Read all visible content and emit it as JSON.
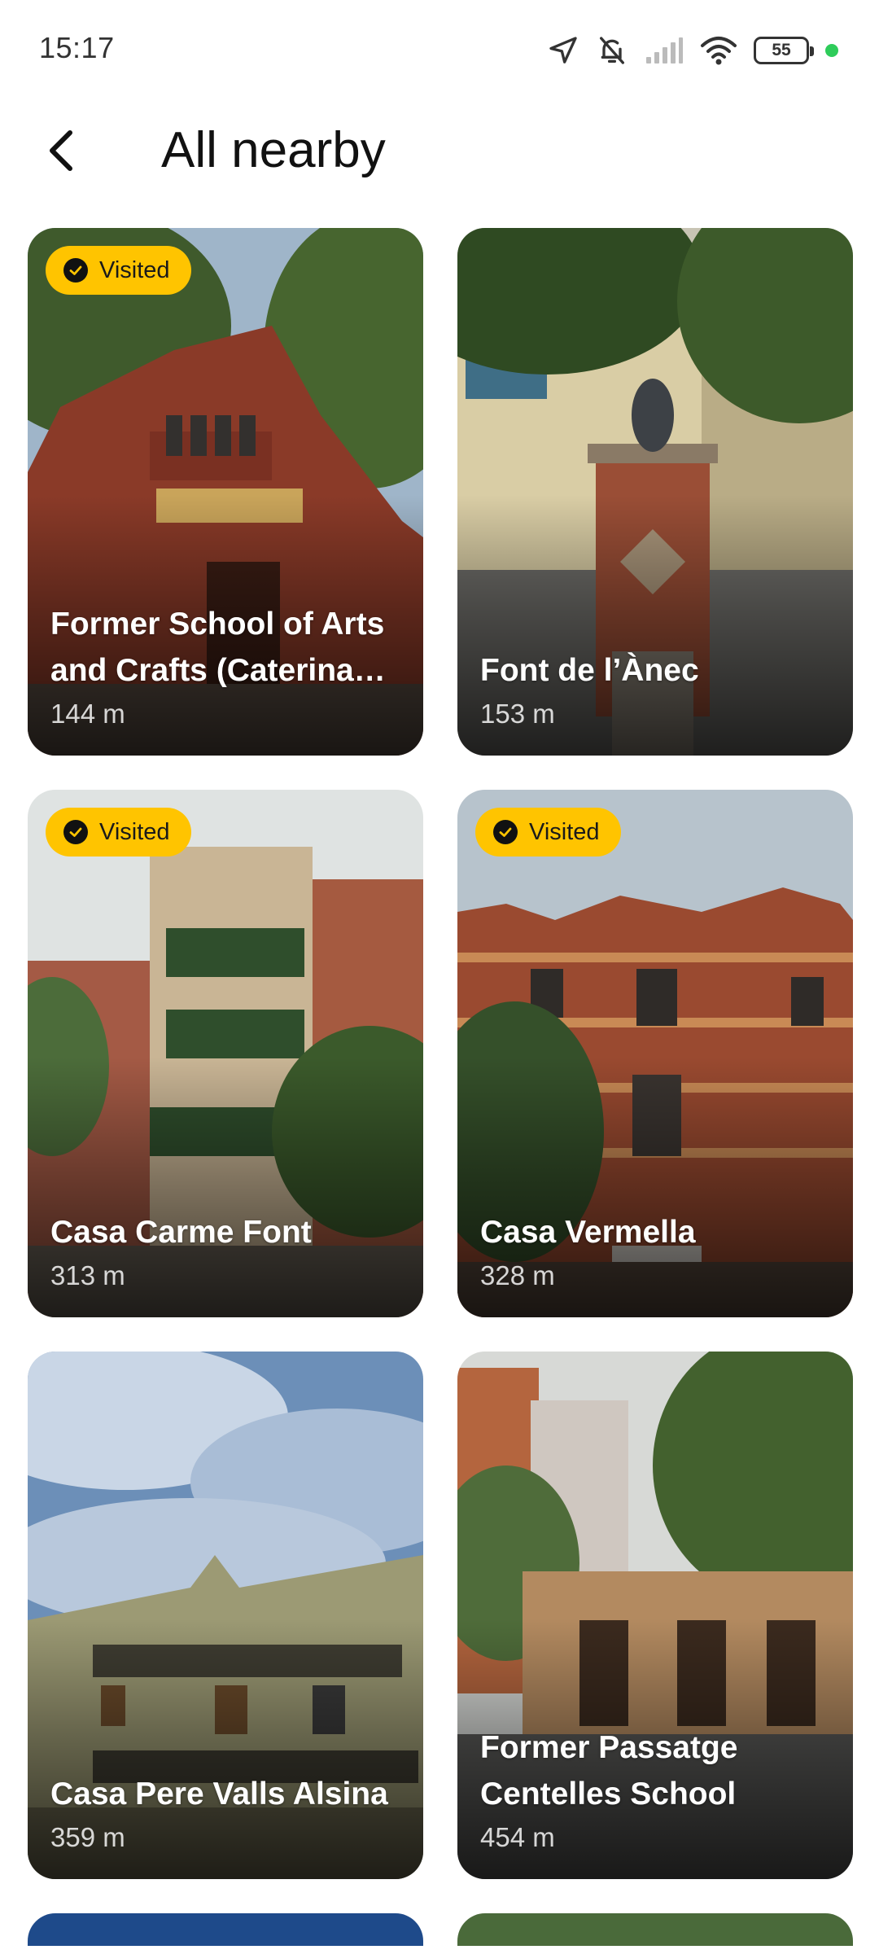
{
  "status_bar": {
    "time": "15:17",
    "battery": "55",
    "icons": [
      "location-arrow-icon",
      "bell-muted-icon",
      "signal-icon",
      "wifi-icon",
      "battery-icon",
      "privacy-dot-icon"
    ],
    "dot_color": "#2ecc5a"
  },
  "header": {
    "title": "All nearby",
    "back_icon": "chevron-left-icon"
  },
  "badge_label": "Visited",
  "badge_color": "#ffc400",
  "places": [
    {
      "name": "Former School of Arts and Crafts (Caterina Albert)",
      "distance": "144 m",
      "visited": true
    },
    {
      "name": "Font de l’Ànec",
      "distance": "153 m",
      "visited": false
    },
    {
      "name": "Casa Carme Font",
      "distance": "313 m",
      "visited": true
    },
    {
      "name": "Casa Vermella",
      "distance": "328 m",
      "visited": true
    },
    {
      "name": "Casa Pere Valls Alsina",
      "distance": "359 m",
      "visited": false
    },
    {
      "name": "Former Passatge Centelles School",
      "distance": "454 m",
      "visited": false
    }
  ]
}
